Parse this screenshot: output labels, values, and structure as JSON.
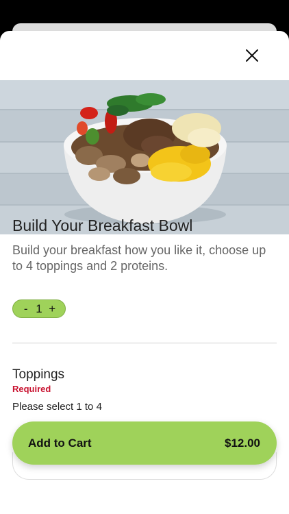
{
  "item": {
    "title": "Build Your Breakfast Bowl",
    "description": "Build your breakfast how you like it, choose up to 4 toppings and 2 proteins.",
    "image_icon": "breakfast-bowl-photo"
  },
  "quantity": {
    "minus_label": "-",
    "value": "1",
    "plus_label": "+"
  },
  "toppings": {
    "title": "Toppings",
    "required_label": "Required",
    "hint": "Please select 1 to 4"
  },
  "cart": {
    "label": "Add to Cart",
    "price": "$12.00"
  },
  "colors": {
    "accent": "#9fd25a",
    "required": "#c8102e"
  }
}
